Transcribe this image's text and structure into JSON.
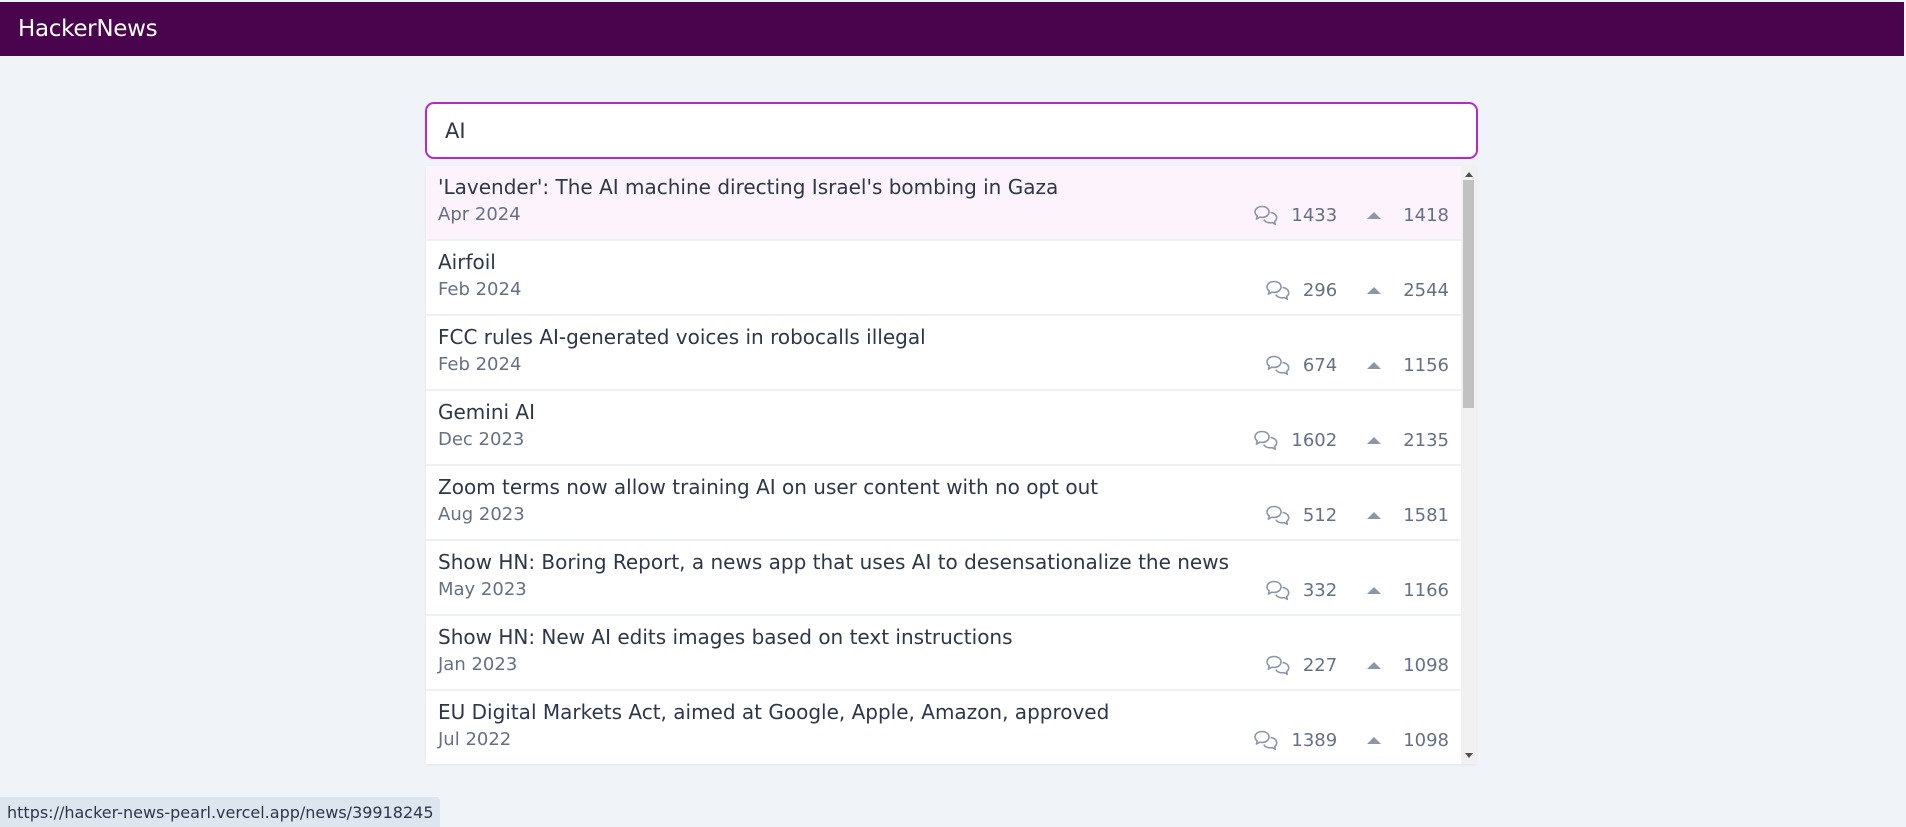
{
  "app": {
    "title": "HackerNews"
  },
  "search": {
    "value": "AI"
  },
  "results": [
    {
      "title": "'Lavender': The AI machine directing Israel's bombing in Gaza",
      "date": "Apr 2024",
      "comments": "1433",
      "points": "1418"
    },
    {
      "title": "Airfoil",
      "date": "Feb 2024",
      "comments": "296",
      "points": "2544"
    },
    {
      "title": "FCC rules AI-generated voices in robocalls illegal",
      "date": "Feb 2024",
      "comments": "674",
      "points": "1156"
    },
    {
      "title": "Gemini AI",
      "date": "Dec 2023",
      "comments": "1602",
      "points": "2135"
    },
    {
      "title": "Zoom terms now allow training AI on user content with no opt out",
      "date": "Aug 2023",
      "comments": "512",
      "points": "1581"
    },
    {
      "title": "Show HN: Boring Report, a news app that uses AI to desensationalize the news",
      "date": "May 2023",
      "comments": "332",
      "points": "1166"
    },
    {
      "title": "Show HN: New AI edits images based on text instructions",
      "date": "Jan 2023",
      "comments": "227",
      "points": "1098"
    },
    {
      "title": "EU Digital Markets Act, aimed at Google, Apple, Amazon, approved",
      "date": "Jul 2022",
      "comments": "1389",
      "points": "1098"
    }
  ],
  "status": {
    "url": "https://hacker-news-pearl.vercel.app/news/39918245"
  },
  "icons": {
    "comment": "comment-bubbles-icon",
    "upvote": "upvote-triangle-icon"
  },
  "colors": {
    "header": "#4a044e",
    "accent": "#b42bc3",
    "highlight": "#fcf3fd"
  }
}
